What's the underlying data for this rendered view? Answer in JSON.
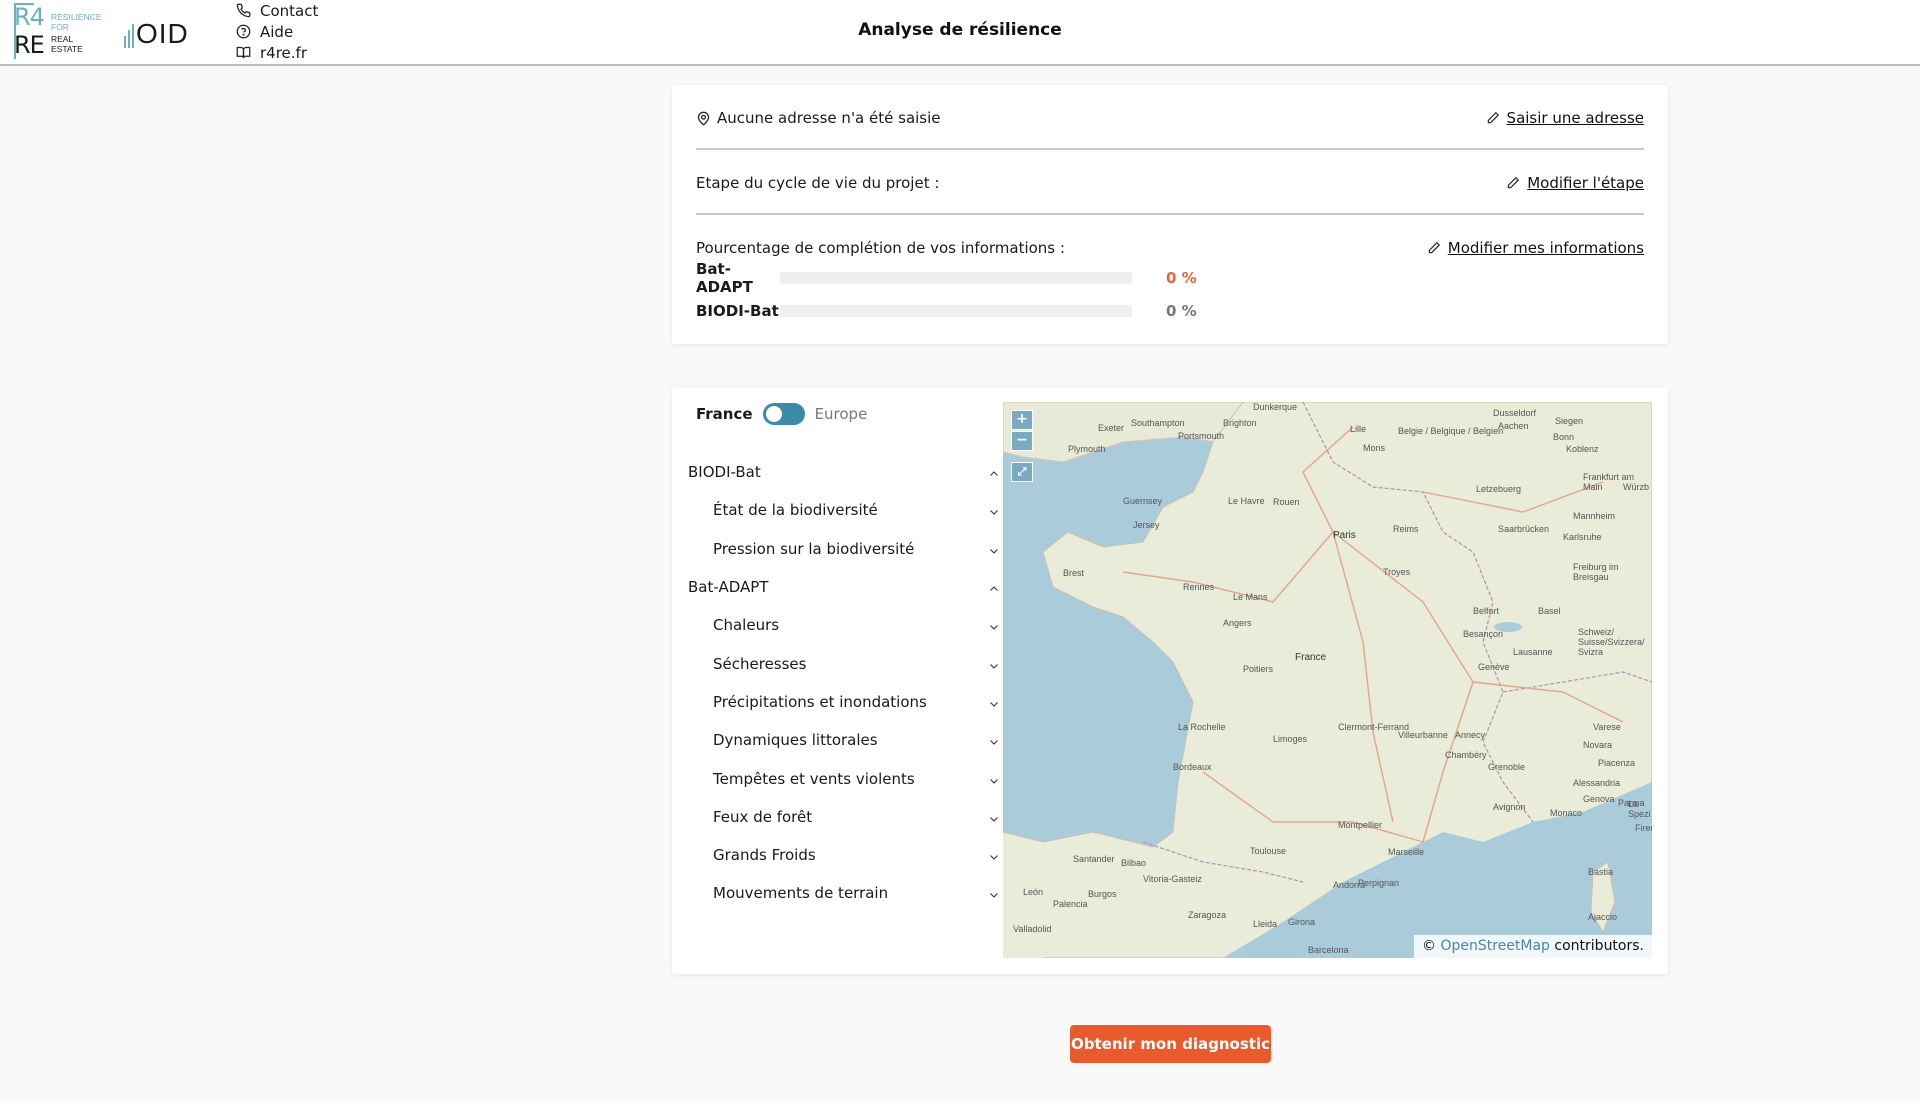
{
  "header": {
    "logo_r4re": {
      "line1": "R4",
      "line2": "RE",
      "s1": "RESILIENCE",
      "s2": "FOR",
      "s3": "REAL",
      "s4": "ESTATE"
    },
    "logo_oid": "OID",
    "links": [
      {
        "label": "Contact",
        "icon": "phone-icon"
      },
      {
        "label": "Aide",
        "icon": "help-circle-icon"
      },
      {
        "label": "r4re.fr",
        "icon": "book-open-icon"
      }
    ],
    "title": "Analyse de résilience"
  },
  "info": {
    "address_text": "Aucune adresse n'a été saisie",
    "address_action": "Saisir une adresse",
    "step_text": "Etape du cycle de vie du projet :",
    "step_action": "Modifier l'étape",
    "pct_text": "Pourcentage de complétion de vos informations :",
    "pct_action": "Modifier mes informations",
    "progress": [
      {
        "label": "Bat-ADAPT",
        "value_text": "0 %",
        "fraction": 0,
        "color": "#e8663a"
      },
      {
        "label": "BIODI-Bat",
        "value_text": "0 %",
        "fraction": 0,
        "color": "#777777"
      }
    ]
  },
  "layers": {
    "toggle_left": "France",
    "toggle_right": "Europe",
    "groups": [
      {
        "label": "BIODI-Bat",
        "expanded": true,
        "children": [
          "État de la biodiversité",
          "Pression sur la biodiversité"
        ]
      },
      {
        "label": "Bat-ADAPT",
        "expanded": true,
        "children": [
          "Chaleurs",
          "Sécheresses",
          "Précipitations et inondations",
          "Dynamiques littorales",
          "Tempêtes et vents violents",
          "Feux de forêt",
          "Grands Froids",
          "Mouvements de terrain"
        ]
      }
    ]
  },
  "map": {
    "zoom_in": "+",
    "zoom_out": "−",
    "fullscreen": "⤢",
    "attribution_prefix": "©",
    "attribution_link": "OpenStreetMap",
    "attribution_suffix": "contributors.",
    "labels": [
      "Dunkerque",
      "Lille",
      "Dusseldorf",
      "Siegen",
      "Aachen",
      "Bonn",
      "Koblenz",
      "Mons",
      "Belgie / Belgique / Belgien",
      "Frankfurt am Main",
      "Würzb",
      "Plymouth",
      "Exeter",
      "Southampton",
      "Brighton",
      "Portsmouth",
      "Guernsey",
      "Jersey",
      "Le Havre",
      "Rouen",
      "Paris",
      "Reims",
      "Letzebuerg",
      "Saarbrücken",
      "Mannheim",
      "Karlsruhe",
      "Troyes",
      "Brest",
      "Rennes",
      "Le Mans",
      "Angers",
      "Freiburg im Breisgau",
      "Belfort",
      "Basel",
      "Besançon",
      "Schweiz/ Suisse/Svizzera/ Svizra",
      "Lausanne",
      "Genève",
      "Poitiers",
      "France",
      "La Rochelle",
      "Limoges",
      "Clermont-Ferrand",
      "Villeurbanne",
      "Annecy",
      "Chambéry",
      "Varese",
      "Novara",
      "Grenoble",
      "Piacenza",
      "Bordeaux",
      "Alessandria",
      "Genova",
      "Parma",
      "Avignon",
      "Monaco",
      "La Spezi",
      "Toulouse",
      "Montpellier",
      "Marseille",
      "Santander",
      "Bilbao",
      "Vitoria-Gasteiz",
      "Burgos",
      "León",
      "Palencia",
      "Valladolid",
      "Zaragoza",
      "Lleida",
      "Girona",
      "Barcelona",
      "Andorra",
      "Perpignan",
      "Bastia",
      "Ajaccio",
      "Firen"
    ],
    "colors": {
      "sea": "#aacbd9",
      "land": "#e9ecd8"
    }
  },
  "cta": "Obtenir mon diagnostic"
}
